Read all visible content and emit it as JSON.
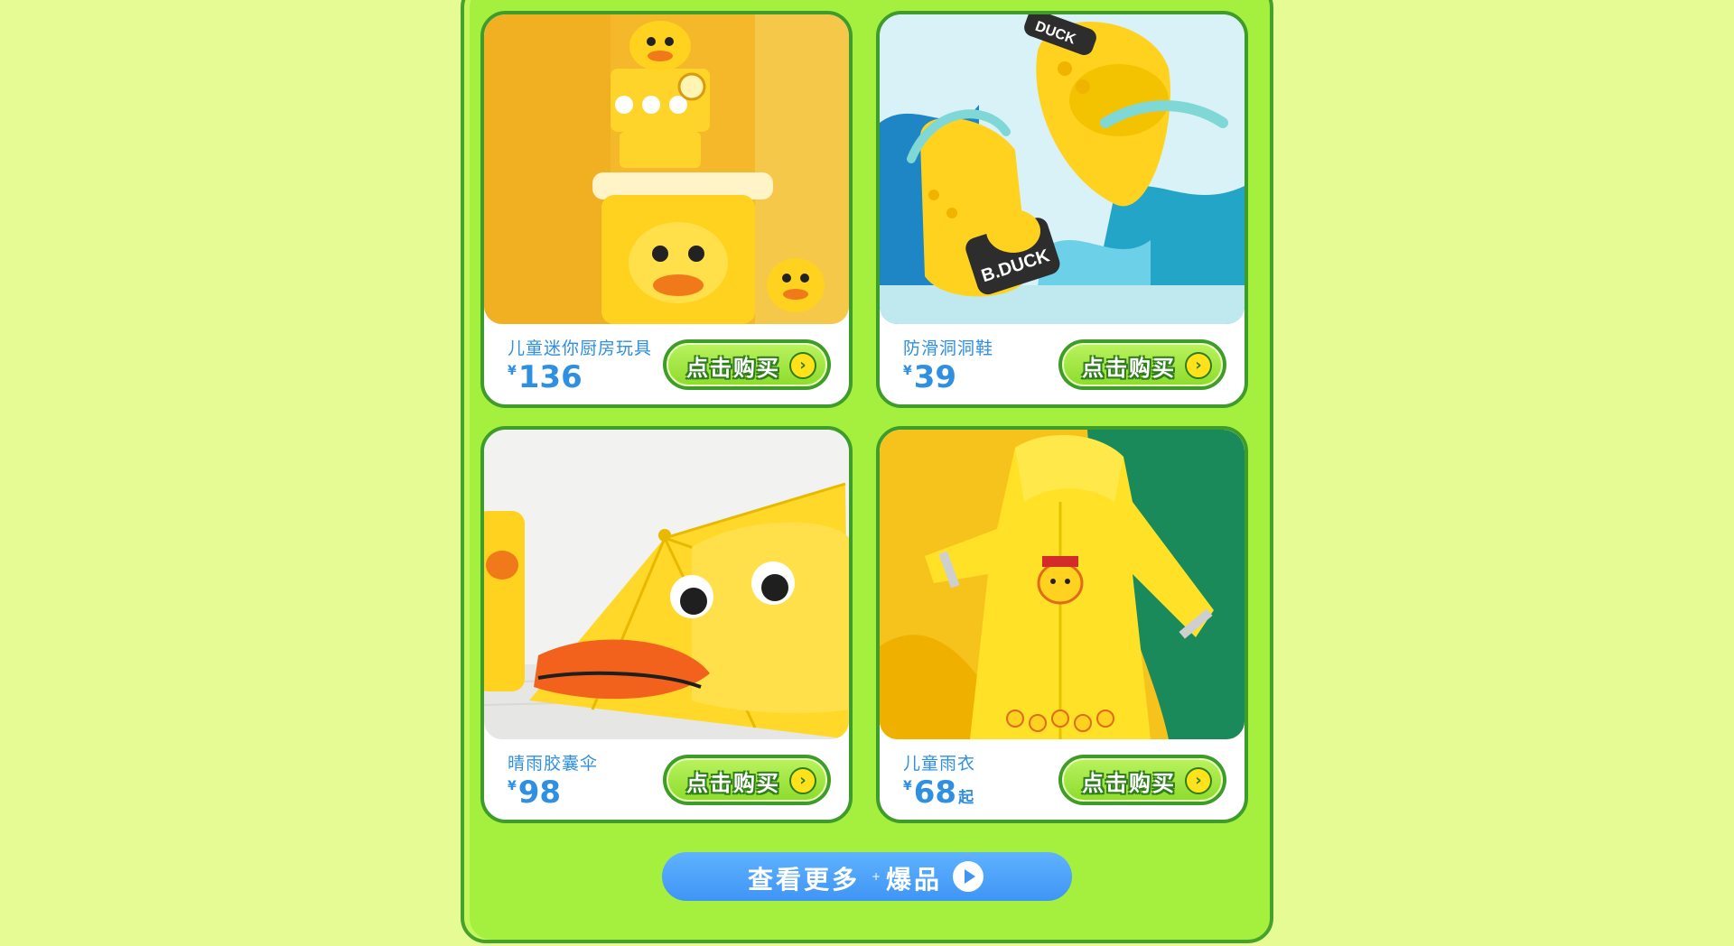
{
  "buttons": {
    "buy_label": "点击购买",
    "more_label_part1": "查看更多",
    "more_separator": "+",
    "more_label_part2": "爆品"
  },
  "products": [
    {
      "name": "儿童迷你厨房玩具",
      "currency": "¥",
      "price": "136",
      "suffix": ""
    },
    {
      "name": "防滑洞洞鞋",
      "currency": "¥",
      "price": "39",
      "suffix": ""
    },
    {
      "name": "晴雨胶囊伞",
      "currency": "¥",
      "price": "98",
      "suffix": ""
    },
    {
      "name": "儿童雨衣",
      "currency": "¥",
      "price": "68",
      "suffix": "起"
    }
  ],
  "product_image_text": {
    "shoe_badge": "B.DUCK",
    "shoe_top_badge": "DUCK"
  },
  "colors": {
    "page_background": "#e6fb94",
    "panel_green": "#a5f03f",
    "panel_border": "#46a22d",
    "price_blue": "#2f8fe0",
    "more_button_blue": "#3f95f5",
    "duck_yellow": "#ffd21f"
  },
  "icons": {
    "buy_arrow": "chevron-right-icon",
    "more_play": "play-icon"
  }
}
